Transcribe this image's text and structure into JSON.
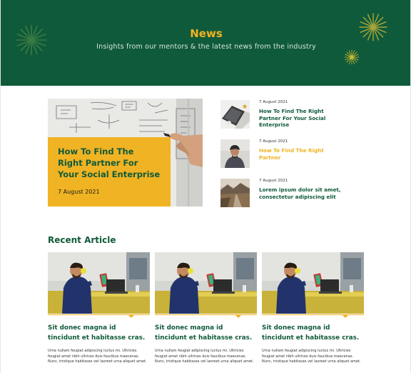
{
  "hero": {
    "title": "News",
    "subtitle": "Insights from our mentors & the latest news from the industry"
  },
  "featured": {
    "title": "How To Find The Right Partner For Your Social Enterprise",
    "date": "7 August 2021"
  },
  "side_news": [
    {
      "date": "7 August 2021",
      "title": "How To Find The Right Partner For Your Social Enterprise",
      "accent": false,
      "thumb": "laptop-desk-photo"
    },
    {
      "date": "7 August 2021",
      "title": "How To Find The Right Partner",
      "accent": true,
      "thumb": "man-portrait-photo"
    },
    {
      "date": "7 August 2021",
      "title": "Lorem ipsum dolor sit amet, consectetur adipiscing elit",
      "accent": false,
      "thumb": "mountain-road-photo"
    }
  ],
  "recent": {
    "heading": "Recent Article",
    "articles": [
      {
        "title": "Sit donec magna id tincidunt et habitasse cras.",
        "body": "Urna nullam feugiat adipiscing luctus mi. Ultricies feugiat amet nibh ultrices duis faucibus maecenas. Nunc, tristique habitasse vel laoreet urna aliquet amet."
      },
      {
        "title": "Sit donec magna id tincidunt et habitasse cras.",
        "body": "Urna nullam feugiat adipiscing luctus mi. Ultricies feugiat amet nibh ultrices duis faucibus maecenas. Nunc, tristique habitasse vel laoreet urna aliquet amet."
      },
      {
        "title": "Sit donec magna id tincidunt et habitasse cras.",
        "body": "Urna nullam feugiat adipiscing luctus mi. Ultricies feugiat amet nibh ultrices duis faucibus maecenas. Nunc, tristique habitasse vel laoreet urna aliquet amet."
      }
    ]
  },
  "colors": {
    "brand_green": "#0f5a3a",
    "accent_yellow": "#f0b323"
  }
}
